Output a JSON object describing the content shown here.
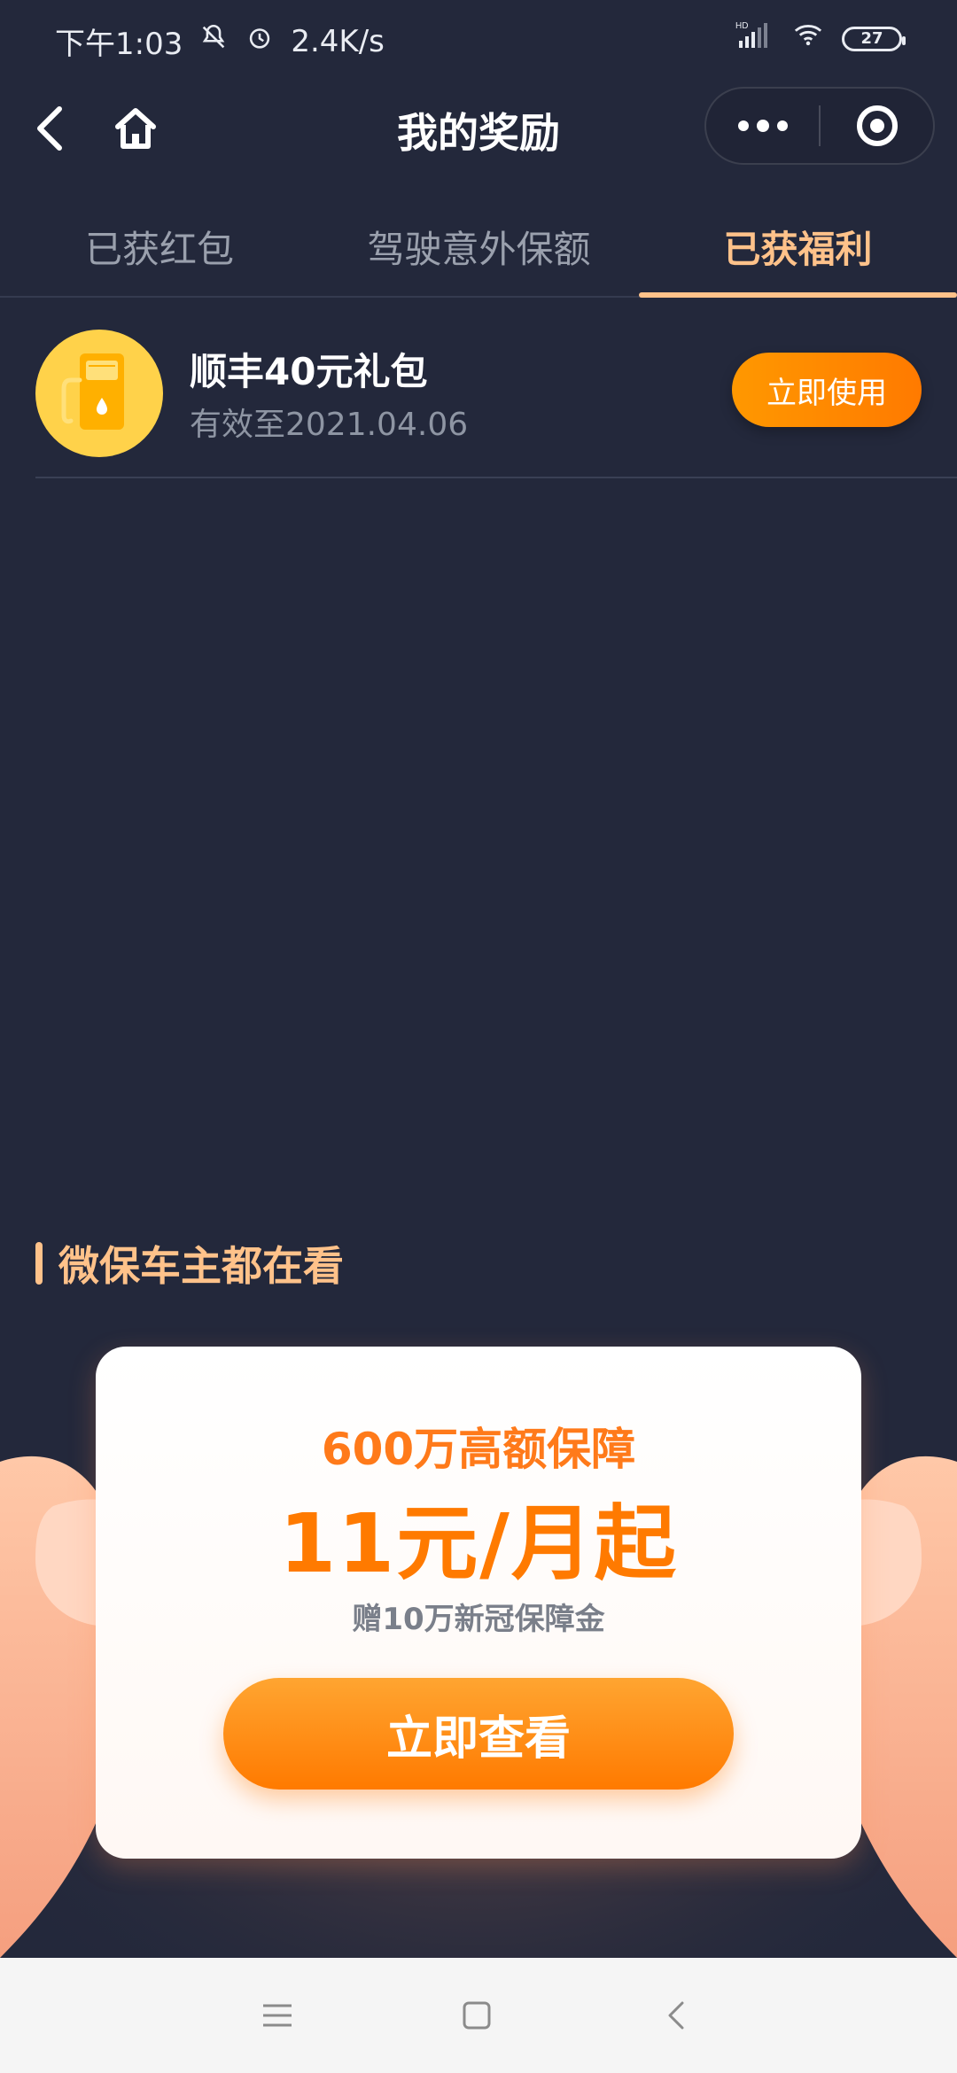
{
  "status_bar": {
    "time": "下午1:03",
    "net_speed": "2.4K/s",
    "battery_level": "27",
    "signal_label": "HD"
  },
  "nav": {
    "title": "我的奖励"
  },
  "tabs": [
    {
      "label": "已获红包",
      "active": false
    },
    {
      "label": "驾驶意外保额",
      "active": false
    },
    {
      "label": "已获福利",
      "active": true
    }
  ],
  "reward": {
    "title": "顺丰40元礼包",
    "expiry": "有效至2021.04.06",
    "button_label": "立即使用",
    "icon": "fuel-pump-icon"
  },
  "section": {
    "title": "微保车主都在看"
  },
  "promo": {
    "line1": "600万高额保障",
    "line2": "11元/月起",
    "line3": "赠10万新冠保障金",
    "button_label": "立即查看"
  },
  "colors": {
    "background": "#23283b",
    "accent_tab": "#ffc28a",
    "orange": "#ff7a00",
    "icon_yellow": "#ffd24a"
  }
}
